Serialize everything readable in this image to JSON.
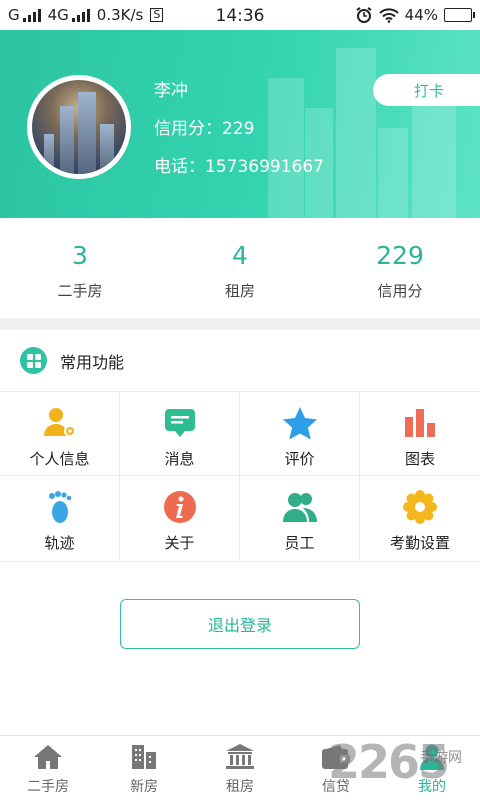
{
  "status_bar": {
    "carrier1": "G",
    "carrier2": "4G",
    "speed": "0.3K/s",
    "speed_badge": "S",
    "time": "14:36",
    "battery": "44%",
    "battery_level": 0.44
  },
  "profile": {
    "name": "李冲",
    "credit": "信用分：229",
    "phone": "电话：15736991667",
    "checkin_label": "打卡"
  },
  "stats": [
    {
      "value": "3",
      "label": "二手房"
    },
    {
      "value": "4",
      "label": "租房"
    },
    {
      "value": "229",
      "label": "信用分"
    }
  ],
  "section": {
    "title": "常用功能"
  },
  "functions": [
    {
      "label": "个人信息",
      "icon": "user-gear-icon"
    },
    {
      "label": "消息",
      "icon": "message-icon"
    },
    {
      "label": "评价",
      "icon": "star-icon"
    },
    {
      "label": "图表",
      "icon": "bar-chart-icon"
    },
    {
      "label": "轨迹",
      "icon": "footprint-icon"
    },
    {
      "label": "关于",
      "icon": "info-icon"
    },
    {
      "label": "员工",
      "icon": "staff-icon"
    },
    {
      "label": "考勤设置",
      "icon": "gear-icon"
    }
  ],
  "logout_label": "退出登录",
  "tabs": [
    {
      "label": "二手房",
      "icon": "house-icon"
    },
    {
      "label": "新房",
      "icon": "building-icon"
    },
    {
      "label": "租房",
      "icon": "bank-icon"
    },
    {
      "label": "信贷",
      "icon": "wallet-icon"
    },
    {
      "label": "我的",
      "icon": "person-icon"
    }
  ],
  "watermark": {
    "number": "2265",
    "text": "手游网"
  },
  "colors": {
    "accent": "#2cc4a2",
    "accent_text": "#2ab59b"
  }
}
